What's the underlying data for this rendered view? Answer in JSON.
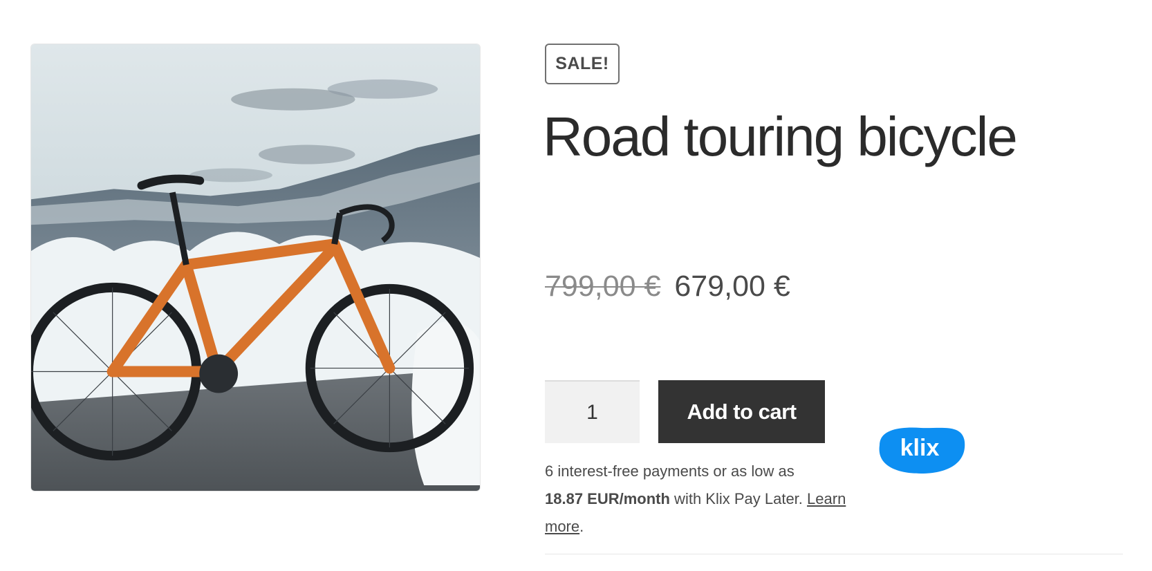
{
  "product": {
    "image_alt": "Orange road touring bicycle parked in snowy mountains",
    "sale_badge": "SALE!",
    "title": "Road touring bicycle",
    "price_old": "799,00 €",
    "price_new": "679,00 €",
    "quantity": "1",
    "add_to_cart_label": "Add to cart"
  },
  "klix": {
    "line1": "6 interest-free payments or as low as",
    "amount": "18.87 EUR/month",
    "after_amount": " with Klix Pay Later. ",
    "link_label": "Learn more",
    "period": ".",
    "logo_text": "klix",
    "logo_color": "#0d8ff2"
  },
  "colors": {
    "button_bg": "#333333",
    "bike_orange": "#d8732b"
  },
  "icons": {
    "klix_logo": "klix-logo-icon"
  }
}
